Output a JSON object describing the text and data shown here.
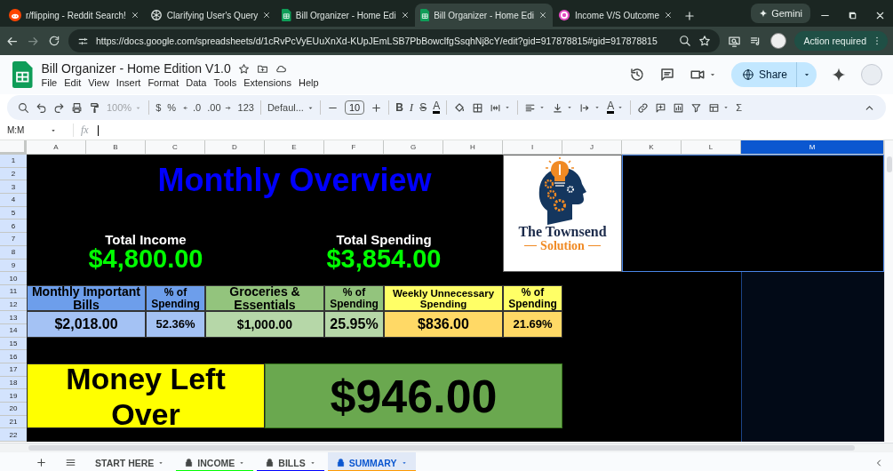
{
  "browser": {
    "tabs": [
      {
        "title": "r/flipping - Reddit Search!",
        "kind": "reddit",
        "selected": false
      },
      {
        "title": "Clarifying User's Query",
        "kind": "chat",
        "selected": false
      },
      {
        "title": "Bill Organizer - Home Edi",
        "kind": "sheets",
        "selected": false
      },
      {
        "title": "Bill Organizer - Home Edi",
        "kind": "sheets",
        "selected": true
      },
      {
        "title": "Income V/S Outcome",
        "kind": "circle",
        "selected": false
      }
    ],
    "gemini_button": "Gemini",
    "url": "https://docs.google.com/spreadsheets/d/1cRvPcVyEUuXnXd-KUpJEmLSB7PbBowclfgSsqhNj8cY/edit?gid=917878815#gid=917878815",
    "action_button": "Action required"
  },
  "document": {
    "title": "Bill Organizer - Home Edition V1.0",
    "menu": [
      "File",
      "Edit",
      "View",
      "Insert",
      "Format",
      "Data",
      "Tools",
      "Extensions",
      "Help"
    ],
    "share_button": "Share"
  },
  "toolbar": {
    "zoom": "100%",
    "currency": "$",
    "percent": "%",
    "decrease_decimal": ".0",
    "increase_decimal": ".00",
    "number_format": "123",
    "font": "Defaul...",
    "font_size": "10",
    "bold": "B",
    "italic": "I",
    "strikethrough": "S",
    "text_color": "A",
    "rotate": "A",
    "functions": "Σ"
  },
  "formula_bar": {
    "name_box": "M:M",
    "fx": "fx"
  },
  "columns": [
    {
      "label": "A",
      "selected": false
    },
    {
      "label": "B",
      "selected": false
    },
    {
      "label": "C",
      "selected": false
    },
    {
      "label": "D",
      "selected": false
    },
    {
      "label": "E",
      "selected": false
    },
    {
      "label": "F",
      "selected": false
    },
    {
      "label": "G",
      "selected": false
    },
    {
      "label": "H",
      "selected": false
    },
    {
      "label": "I",
      "selected": false
    },
    {
      "label": "J",
      "selected": false
    },
    {
      "label": "K",
      "selected": false
    },
    {
      "label": "L",
      "selected": false
    },
    {
      "label": "M",
      "selected": true
    }
  ],
  "rows": [
    "1",
    "2",
    "3",
    "4",
    "5",
    "6",
    "7",
    "8",
    "9",
    "10",
    "11",
    "12",
    "13",
    "14",
    "15",
    "16",
    "17",
    "18",
    "19",
    "20",
    "21",
    "22"
  ],
  "sheet": {
    "title": "Monthly Overview",
    "income_label": "Total Income",
    "income_value": "$4,800.00",
    "spending_label": "Total Spending",
    "spending_value": "$3,854.00",
    "categories": [
      {
        "header": {
          "name": "Monthly Important Bills",
          "percent_label": "% of Spending",
          "color": "#6d9eeb"
        },
        "amount": {
          "value": "$2,018.00",
          "percent": "52.36%",
          "color": "#a4c2f4"
        }
      },
      {
        "header": {
          "name": "Groceries & Essentials",
          "percent_label": "% of Spending",
          "color": "#93c47d"
        },
        "amount": {
          "value": "$1,000.00",
          "percent": "25.95%",
          "color": "#b6d7a8"
        }
      },
      {
        "header": {
          "name": "Weekly Unnecessary Spending",
          "percent_label": "% of Spending",
          "color": "#ffff66"
        },
        "amount": {
          "value": "$836.00",
          "percent": "21.69%",
          "color": "#ffd966"
        }
      }
    ],
    "left_over_label": "Money Left Over",
    "left_over_value": "$946.00"
  },
  "logo": {
    "line1": "The Townsend",
    "line2": "Solution"
  },
  "sheet_tabs": [
    {
      "label": "START HERE",
      "locked": false,
      "selected": false
    },
    {
      "label": "INCOME",
      "locked": true,
      "selected": false,
      "color": "#00ff00"
    },
    {
      "label": "BILLS",
      "locked": true,
      "selected": false,
      "color": "#0000ff"
    },
    {
      "label": "SUMMARY",
      "locked": true,
      "selected": true,
      "color": "#ff9900"
    }
  ]
}
